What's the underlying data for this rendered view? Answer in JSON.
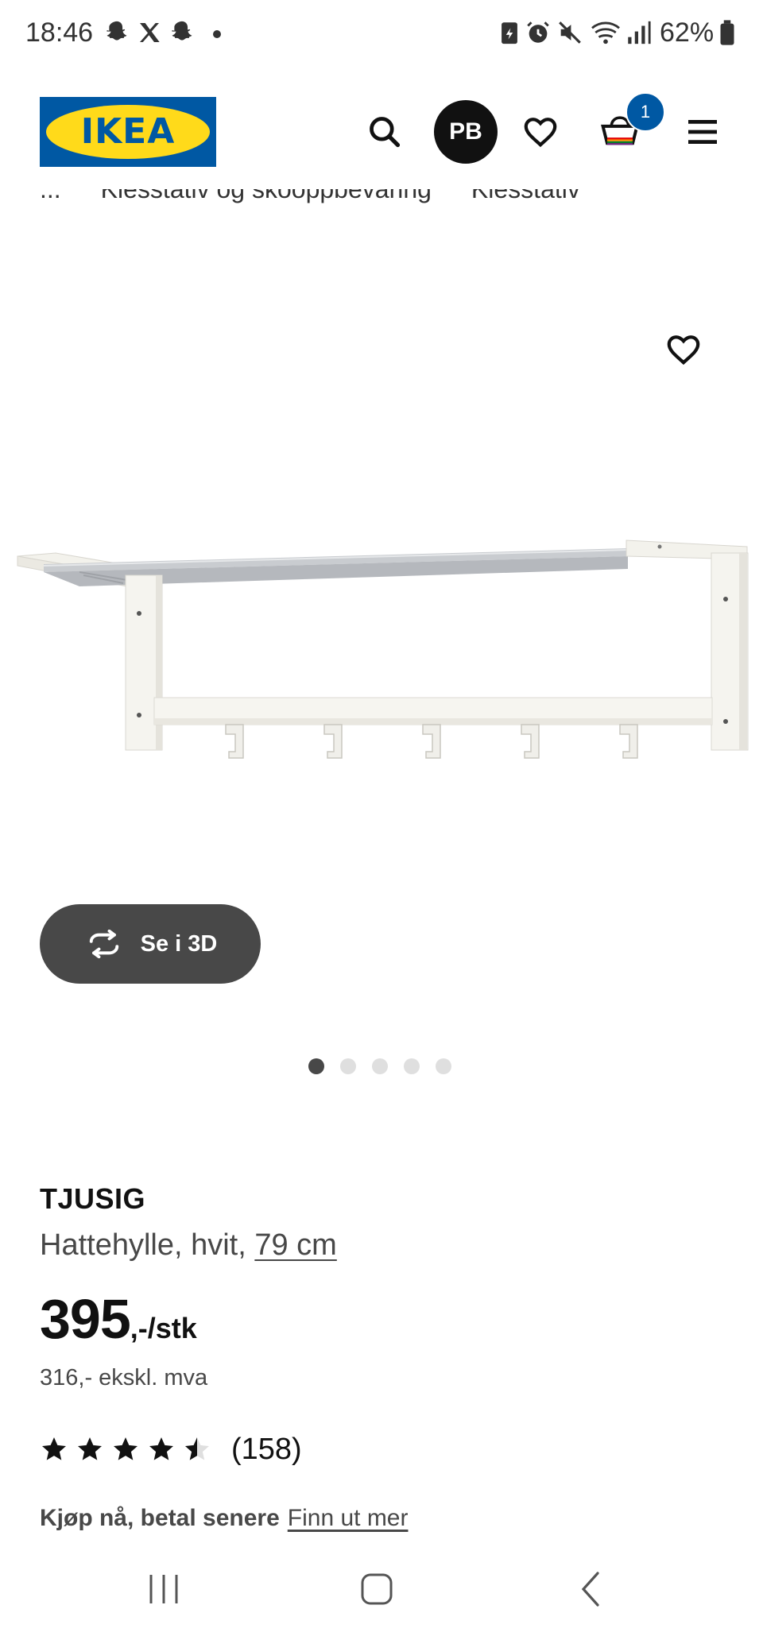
{
  "status_bar": {
    "time": "18:46",
    "battery": "62%",
    "icons": [
      "snapchat-icon",
      "x-icon",
      "snapchat-icon",
      "dot-icon",
      "battery-saver-icon",
      "alarm-icon",
      "mute-icon",
      "wifi-icon",
      "signal-icon",
      "battery-icon"
    ]
  },
  "header": {
    "logo_text": "IKEA",
    "avatar_initials": "PB",
    "cart_count": "1",
    "icons": [
      "search-icon",
      "heart-icon",
      "cart-icon",
      "menu-icon"
    ]
  },
  "breadcrumb": {
    "items": [
      "...",
      "Klesstativ og skooppbevaring",
      "Klesstativ"
    ]
  },
  "gallery": {
    "view_3d_label": "Se i 3D",
    "image_count": 5,
    "active_index": 0
  },
  "product": {
    "name": "TJUSIG",
    "description_prefix": "Hattehylle, hvit, ",
    "size_link": "79 cm",
    "price": "395",
    "price_suffix": ",-/stk",
    "price_ex_vat": "316,- ekskl. mva",
    "rating": 4.5,
    "rating_count": "(158)",
    "bnpl_label": "Kjøp nå, betal senere",
    "bnpl_link": "Finn ut mer"
  },
  "colors": {
    "ikea_blue": "#0058a3",
    "ikea_yellow": "#ffda1a",
    "button_dark": "#484848"
  },
  "nav_bar": {
    "icons": [
      "recents-icon",
      "home-icon",
      "back-icon"
    ]
  }
}
